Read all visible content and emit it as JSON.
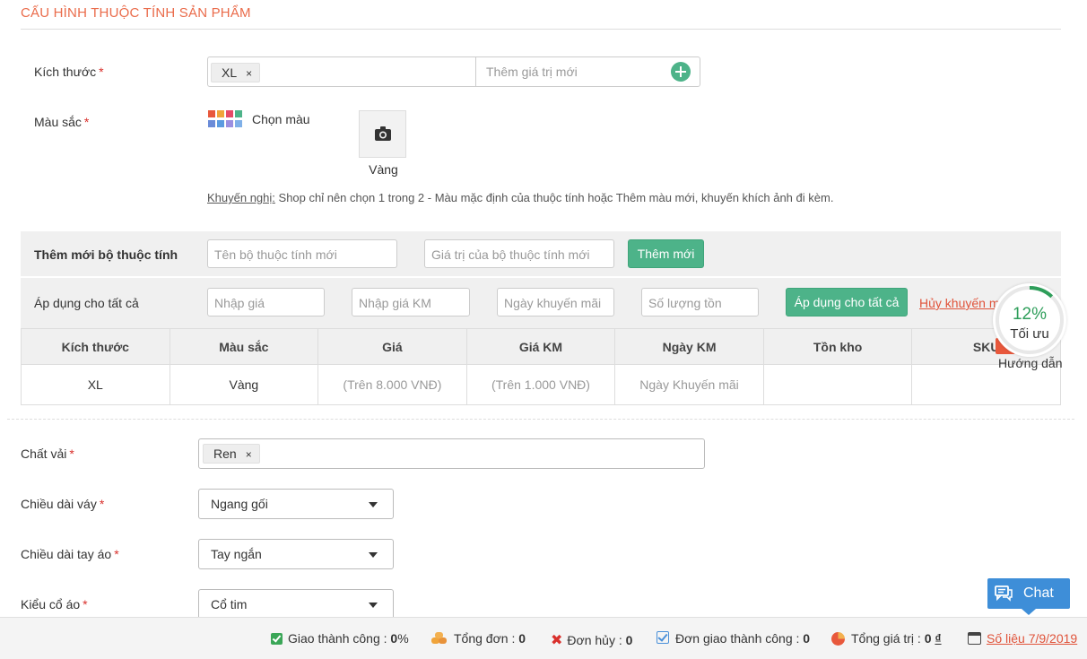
{
  "section": {
    "title": "CẤU HÌNH THUỘC TÍNH SẢN PHẨM"
  },
  "size": {
    "label": "Kích thước",
    "required": "*",
    "tag": "XL",
    "tag_remove": "×",
    "new_value_placeholder": "Thêm giá trị mới"
  },
  "color": {
    "label": "Màu sắc",
    "required": "*",
    "choose_label": "Chọn màu",
    "swatch_name": "Vàng",
    "hint_prefix": "Khuyến nghị:",
    "hint_text": " Shop chỉ nên chọn 1 trong 2 - Màu mặc định của thuộc tính hoặc Thêm màu mới, khuyến khích ảnh đi kèm.",
    "palette": [
      "#e8583c",
      "#f0a43a",
      "#e64a67",
      "#4db389",
      "#6a8bd8",
      "#5b9be0",
      "#9b8fe0",
      "#7fb0e8"
    ]
  },
  "add_set": {
    "label": "Thêm mới bộ thuộc tính",
    "name_placeholder": "Tên bộ thuộc tính mới",
    "value_placeholder": "Giá trị của bộ thuộc tính mới",
    "button": "Thêm mới"
  },
  "apply_all": {
    "label": "Áp dụng cho tất cả",
    "price_placeholder": "Nhập giá",
    "promo_price_placeholder": "Nhập giá KM",
    "promo_date_placeholder": "Ngày khuyến mãi",
    "stock_placeholder": "Số lượng tồn",
    "button": "Áp dụng cho tất cả",
    "cancel_link": "Hủy khuyến m"
  },
  "table": {
    "headers": [
      "Kích thước",
      "Màu sắc",
      "Giá",
      "Giá KM",
      "Ngày KM",
      "Tồn kho",
      "SKU"
    ],
    "rows": [
      [
        "XL",
        "Vàng",
        "(Trên 8.000 VNĐ)",
        "(Trên 1.000 VNĐ)",
        "Ngày Khuyến mãi",
        "",
        ""
      ]
    ]
  },
  "optimize": {
    "percent": "12%",
    "label": "Tối ưu",
    "guide": "Hướng dẫn",
    "progress": 0.12
  },
  "fabric": {
    "label": "Chất vải",
    "required": "*",
    "tag": "Ren",
    "tag_remove": "×"
  },
  "skirt_length": {
    "label": "Chiều dài váy",
    "required": "*",
    "value": "Ngang gối"
  },
  "sleeve_length": {
    "label": "Chiều dài tay áo",
    "required": "*",
    "value": "Tay ngắn"
  },
  "collar": {
    "label": "Kiểu cổ áo",
    "required": "*",
    "value": "Cổ tim"
  },
  "chat": {
    "label": "Chat"
  },
  "footer": {
    "success_label": "Giao thành công : ",
    "success_value": "0",
    "success_unit": "%",
    "orders_label": "Tổng đơn : ",
    "orders_value": "0",
    "cancelled_label": "Đơn hủy : ",
    "cancelled_value": "0",
    "delivered_label": "Đơn giao thành công : ",
    "delivered_value": "0",
    "total_label": "Tổng giá trị : ",
    "total_value": "0",
    "total_currency": "₫",
    "report_link": "Số liệu 7/9/2019"
  },
  "colors": {
    "accent": "#ea6b4a",
    "green": "#4db389",
    "chat_blue": "#3e8ed8",
    "link_red": "#e0533a"
  }
}
